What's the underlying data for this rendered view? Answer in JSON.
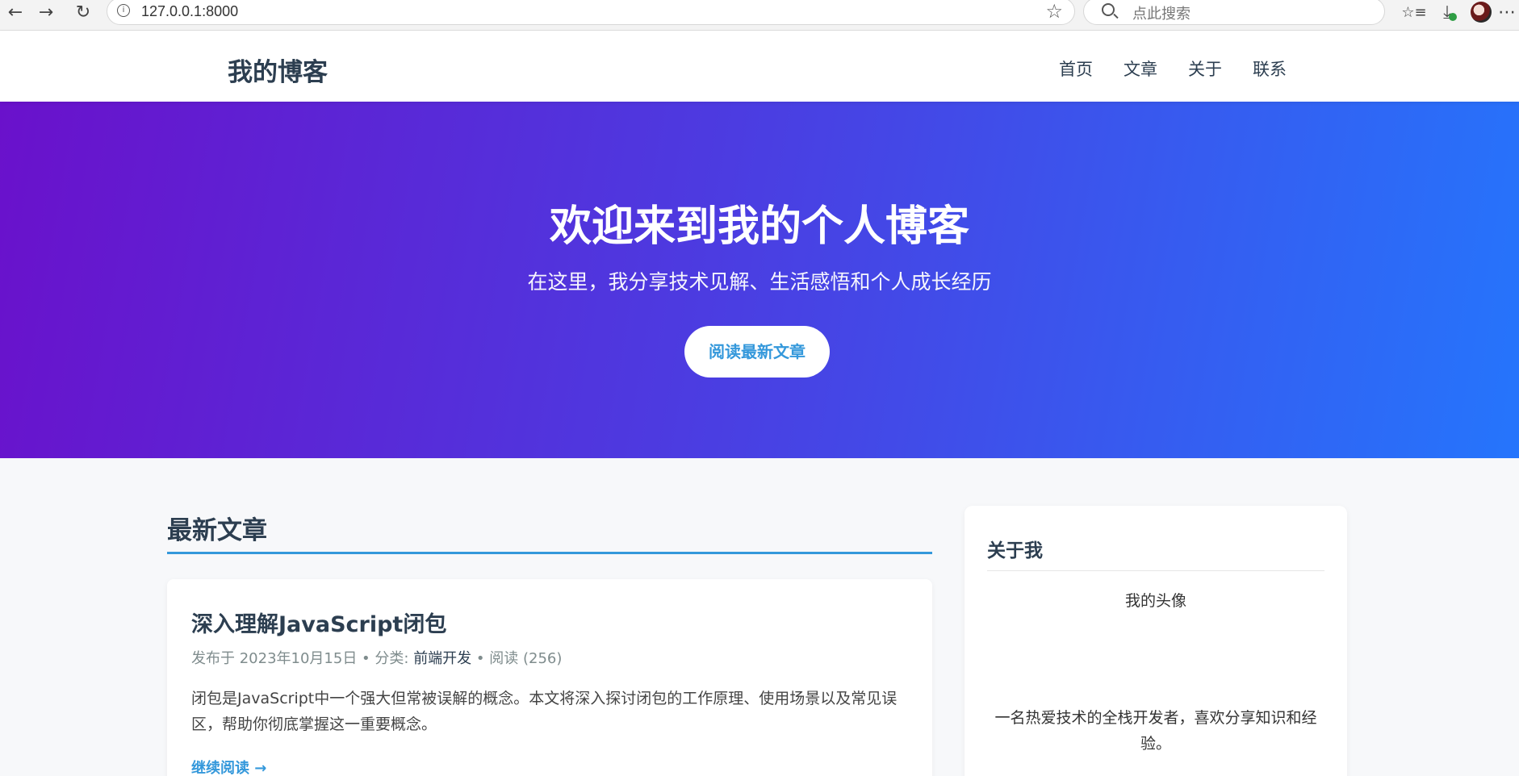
{
  "browser": {
    "url": "127.0.0.1:8000",
    "search_placeholder": "点此搜索",
    "back_icon": "←",
    "forward_icon": "→",
    "reload_icon": "↻",
    "favorite_icon": "☆",
    "favorites_icon": "☆≡",
    "download_icon": "⤓",
    "more_icon": "⋯"
  },
  "header": {
    "logo": "我的博客",
    "nav": [
      {
        "label": "首页"
      },
      {
        "label": "文章"
      },
      {
        "label": "关于"
      },
      {
        "label": "联系"
      }
    ]
  },
  "hero": {
    "title": "欢迎来到我的个人博客",
    "subtitle": "在这里，我分享技术见解、生活感悟和个人成长经历",
    "button": "阅读最新文章"
  },
  "main": {
    "section_title": "最新文章",
    "articles": [
      {
        "title": "深入理解JavaScript闭包",
        "meta_prefix": "发布于 2023年10月15日 • 分类: ",
        "category": "前端开发",
        "meta_suffix": " • 阅读 (256)",
        "excerpt": "闭包是JavaScript中一个强大但常被误解的概念。本文将深入探讨闭包的工作原理、使用场景以及常见误区，帮助你彻底掌握这一重要概念。",
        "read_more": "继续阅读 →"
      }
    ]
  },
  "sidebar": {
    "title": "关于我",
    "avatar_alt": "我的头像",
    "bio": "一名热爱技术的全栈开发者，喜欢分享知识和经验。"
  },
  "colors": {
    "accent": "#3498db",
    "hero_start": "#6a11cb",
    "hero_end": "#2575fc",
    "text": "#2c3e50"
  }
}
